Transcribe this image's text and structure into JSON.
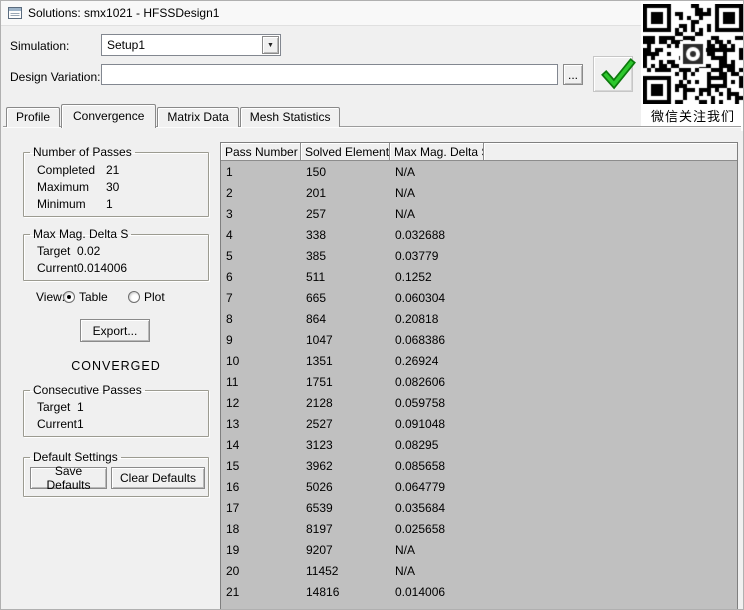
{
  "window": {
    "title": "Solutions: smx1021 - HFSSDesign1"
  },
  "controls": {
    "simulation_label": "Simulation:",
    "simulation_value": "Setup1",
    "design_variation_label": "Design Variation:",
    "design_variation_value": "",
    "browse_label": "...",
    "dropdown_arrow": "▼"
  },
  "qr": {
    "caption": "微信关注我们"
  },
  "tabs": [
    {
      "label": "Profile",
      "active": false
    },
    {
      "label": "Convergence",
      "active": true
    },
    {
      "label": "Matrix Data",
      "active": false
    },
    {
      "label": "Mesh Statistics",
      "active": false
    }
  ],
  "left_panel": {
    "passes": {
      "title": "Number of Passes",
      "items": [
        {
          "label": "Completed",
          "value": "21"
        },
        {
          "label": "Maximum",
          "value": "30"
        },
        {
          "label": "Minimum",
          "value": "1"
        }
      ]
    },
    "delta": {
      "title": "Max Mag. Delta S",
      "items": [
        {
          "label": "Target",
          "value": "0.02"
        },
        {
          "label": "Current",
          "value": "0.014006"
        }
      ]
    },
    "view": {
      "label": "View:",
      "options": [
        {
          "label": "Table",
          "selected": true
        },
        {
          "label": "Plot",
          "selected": false
        }
      ]
    },
    "export_label": "Export...",
    "status": "CONVERGED",
    "consecutive": {
      "title": "Consecutive Passes",
      "items": [
        {
          "label": "Target",
          "value": "1"
        },
        {
          "label": "Current",
          "value": "1"
        }
      ]
    },
    "defaults": {
      "title": "Default Settings",
      "buttons": [
        "Save Defaults",
        "Clear Defaults"
      ]
    }
  },
  "table": {
    "columns": [
      "Pass Number",
      "Solved Elements",
      "Max Mag. Delta S"
    ],
    "rows": [
      [
        "1",
        "150",
        "N/A"
      ],
      [
        "2",
        "201",
        "N/A"
      ],
      [
        "3",
        "257",
        "N/A"
      ],
      [
        "4",
        "338",
        "0.032688"
      ],
      [
        "5",
        "385",
        "0.03779"
      ],
      [
        "6",
        "511",
        "0.1252"
      ],
      [
        "7",
        "665",
        "0.060304"
      ],
      [
        "8",
        "864",
        "0.20818"
      ],
      [
        "9",
        "1047",
        "0.068386"
      ],
      [
        "10",
        "1351",
        "0.26924"
      ],
      [
        "11",
        "1751",
        "0.082606"
      ],
      [
        "12",
        "2128",
        "0.059758"
      ],
      [
        "13",
        "2527",
        "0.091048"
      ],
      [
        "14",
        "3123",
        "0.08295"
      ],
      [
        "15",
        "3962",
        "0.085658"
      ],
      [
        "16",
        "5026",
        "0.064779"
      ],
      [
        "17",
        "6539",
        "0.035684"
      ],
      [
        "18",
        "8197",
        "0.025658"
      ],
      [
        "19",
        "9207",
        "N/A"
      ],
      [
        "20",
        "11452",
        "N/A"
      ],
      [
        "21",
        "14816",
        "0.014006"
      ]
    ]
  },
  "colors": {
    "check_green": "#1fae1f",
    "table_body": "#c0c0c0"
  }
}
